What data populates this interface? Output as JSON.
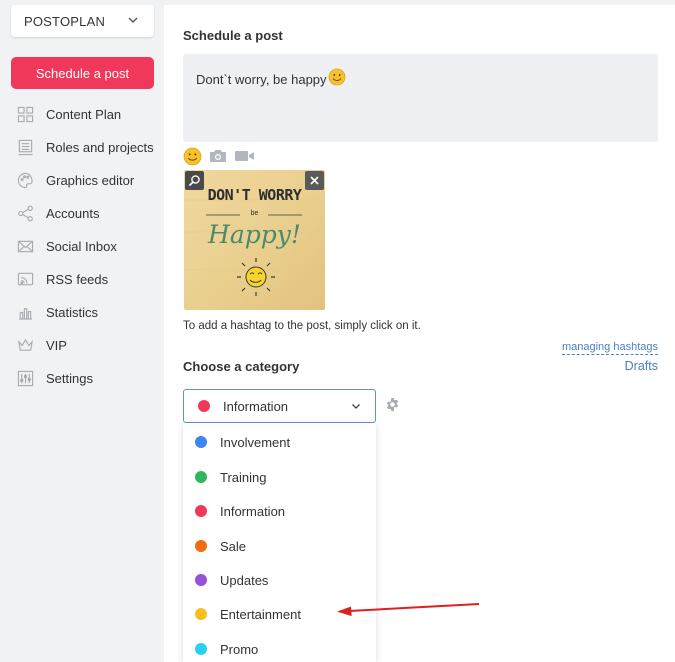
{
  "sidebar": {
    "project": "POSTOPLAN",
    "schedule_label": "Schedule a post",
    "items": [
      {
        "label": "Content Plan",
        "icon": "content-plan-icon"
      },
      {
        "label": "Roles and projects",
        "icon": "roles-icon"
      },
      {
        "label": "Graphics editor",
        "icon": "graphics-icon"
      },
      {
        "label": "Accounts",
        "icon": "share-icon"
      },
      {
        "label": "Social Inbox",
        "icon": "mail-icon"
      },
      {
        "label": "RSS feeds",
        "icon": "rss-icon"
      },
      {
        "label": "Statistics",
        "icon": "stats-icon"
      },
      {
        "label": "VIP",
        "icon": "crown-icon"
      },
      {
        "label": "Settings",
        "icon": "sliders-icon"
      }
    ]
  },
  "post": {
    "title": "Schedule a post",
    "text": "Dont`t worry, be happy",
    "hint": "To add a hashtag to the post, simply click on it.",
    "managing_hashtags": "managing hashtags",
    "drafts": "Drafts",
    "image": {
      "line1": "DON'T WORRY",
      "line2": "be",
      "line3": "Happy!"
    }
  },
  "category": {
    "title": "Choose a category",
    "selected": "Information",
    "selected_color": "#f0385a",
    "options": [
      {
        "label": "Involvement",
        "color": "#3b86f0"
      },
      {
        "label": "Training",
        "color": "#2eb85c"
      },
      {
        "label": "Information",
        "color": "#f0385a"
      },
      {
        "label": "Sale",
        "color": "#f26a12"
      },
      {
        "label": "Updates",
        "color": "#9651d8"
      },
      {
        "label": "Entertainment",
        "color": "#f8be1d"
      },
      {
        "label": "Promo",
        "color": "#26d1f2"
      }
    ]
  },
  "colors": {
    "accent": "#f0385a",
    "link": "#4a7fc2",
    "annotation_arrow": "#e02020"
  }
}
